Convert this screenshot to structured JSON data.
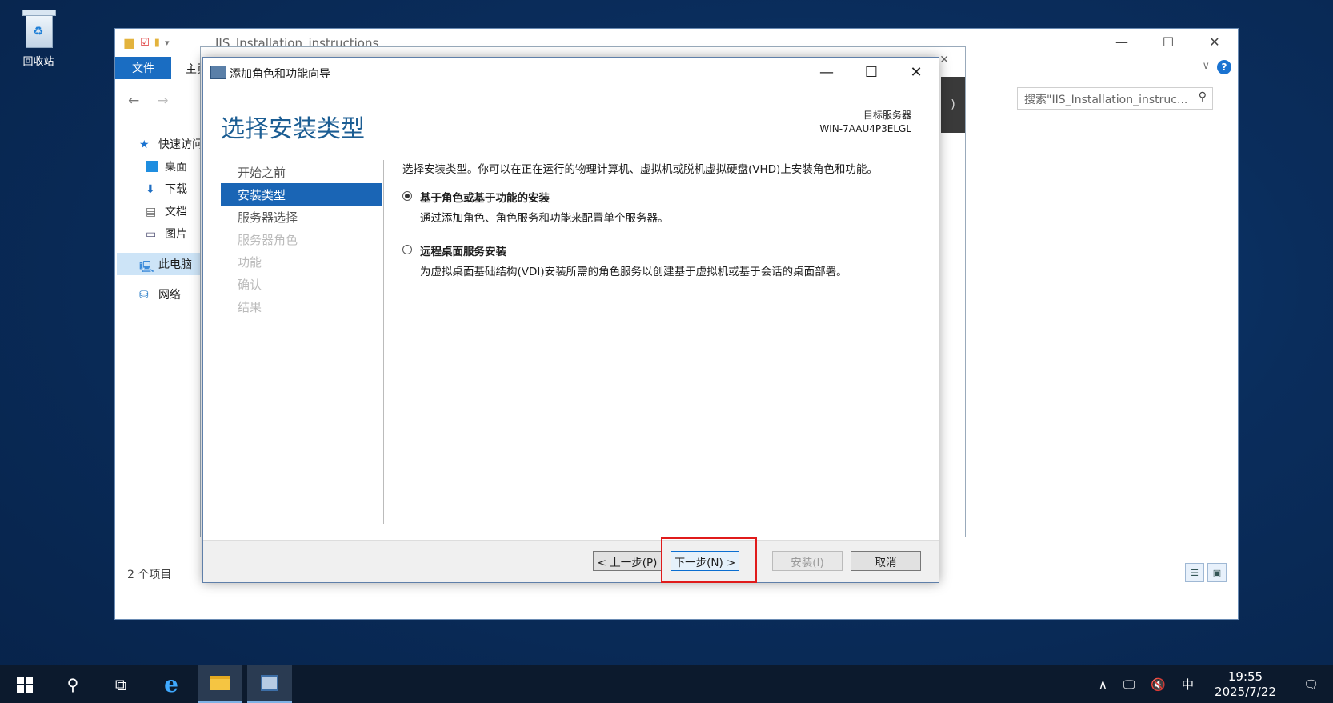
{
  "desktop": {
    "recycle_bin_label": "回收站"
  },
  "explorer": {
    "title": "IIS_Installation_instructions",
    "tab_file": "文件",
    "tab_home": "主页",
    "search_placeholder": "搜索\"IIS_Installation_instruc...",
    "nav_items": [
      {
        "label": "快速访问",
        "icon": "star-icon"
      },
      {
        "label": "桌面",
        "icon": "desktop-icon"
      },
      {
        "label": "下载",
        "icon": "download-icon"
      },
      {
        "label": "文档",
        "icon": "document-icon"
      },
      {
        "label": "图片",
        "icon": "picture-icon"
      },
      {
        "label": "此电脑",
        "icon": "computer-icon"
      },
      {
        "label": "网络",
        "icon": "network-icon"
      }
    ],
    "status": "2 个项目",
    "partial_text": ")"
  },
  "wizard": {
    "title": "添加角色和功能向导",
    "heading": "选择安装类型",
    "target_label": "目标服务器",
    "target_name": "WIN-7AAU4P3ELGL",
    "steps": [
      {
        "label": "开始之前",
        "state": "normal"
      },
      {
        "label": "安装类型",
        "state": "active"
      },
      {
        "label": "服务器选择",
        "state": "normal"
      },
      {
        "label": "服务器角色",
        "state": "dim"
      },
      {
        "label": "功能",
        "state": "dim"
      },
      {
        "label": "确认",
        "state": "dim"
      },
      {
        "label": "结果",
        "state": "dim"
      }
    ],
    "description": "选择安装类型。你可以在正在运行的物理计算机、虚拟机或脱机虚拟硬盘(VHD)上安装角色和功能。",
    "options": [
      {
        "label": "基于角色或基于功能的安装",
        "sub": "通过添加角色、角色服务和功能来配置单个服务器。",
        "selected": true
      },
      {
        "label": "远程桌面服务安装",
        "sub": "为虚拟桌面基础结构(VDI)安装所需的角色服务以创建基于虚拟机或基于会话的桌面部署。",
        "selected": false
      }
    ],
    "buttons": {
      "prev": "< 上一步(P)",
      "next": "下一步(N) >",
      "install": "安装(I)",
      "cancel": "取消"
    }
  },
  "taskbar": {
    "time": "19:55",
    "date": "2025/7/22",
    "ime": "中"
  },
  "colors": {
    "accent": "#1a65b5",
    "heading": "#1b5d93",
    "highlight": "#e01b1b"
  }
}
